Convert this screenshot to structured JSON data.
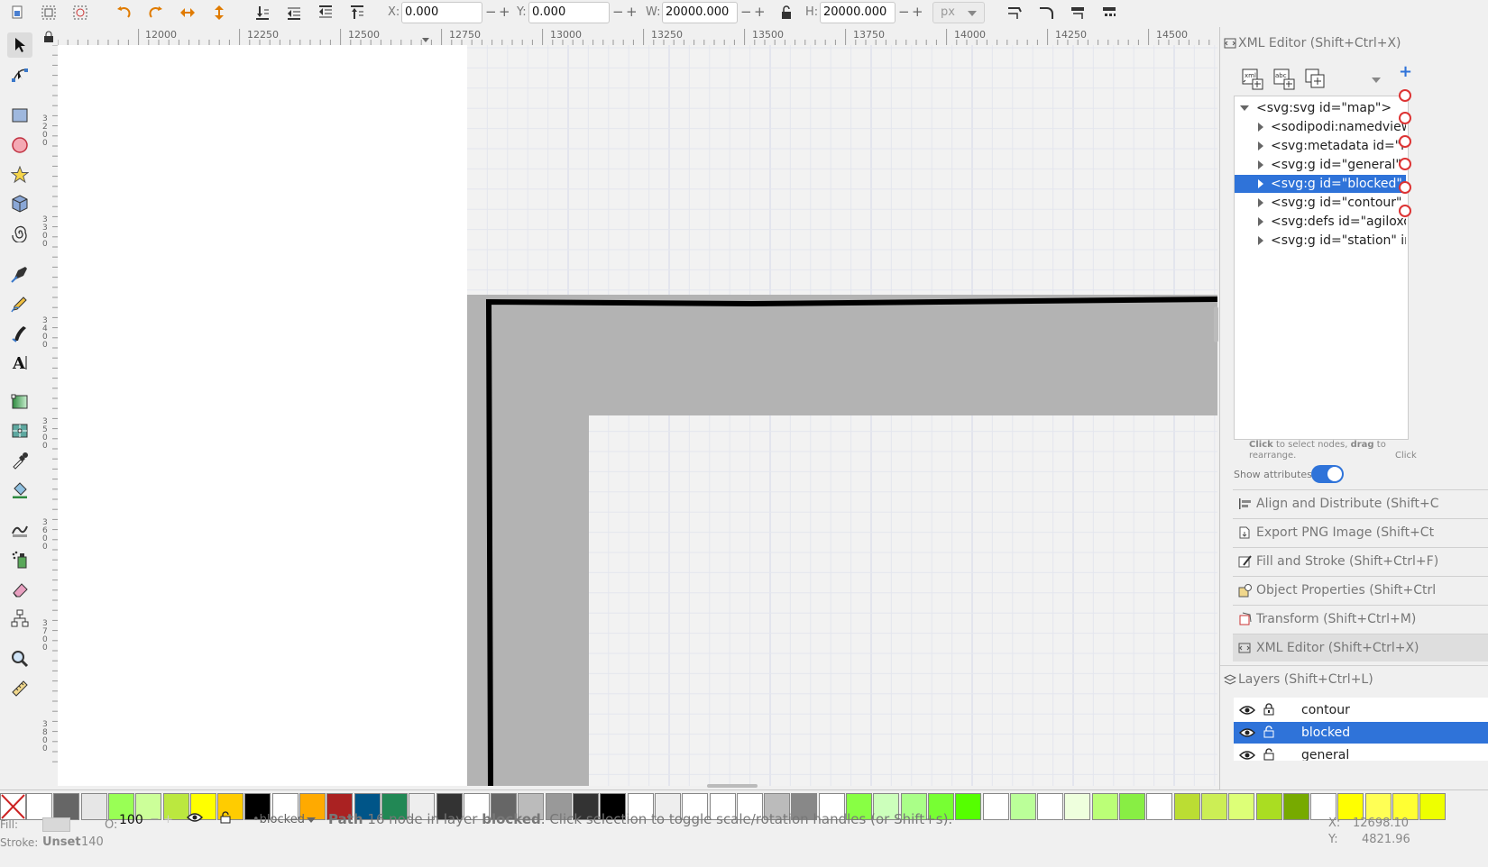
{
  "toolbar": {
    "x_label": "X:",
    "x_value": "0.000",
    "y_label": "Y:",
    "y_value": "0.000",
    "w_label": "W:",
    "w_value": "20000.000",
    "h_label": "H:",
    "h_value": "20000.000",
    "unit": "px",
    "minus": "−",
    "plus": "+"
  },
  "ruler": {
    "labels": [
      "12000",
      "12250",
      "12500",
      "12750",
      "13000",
      "13250",
      "13500",
      "13750",
      "14000",
      "14250",
      "14500"
    ],
    "vlabels": [
      "3200",
      "3300",
      "3400",
      "3500",
      "3600",
      "3700",
      "3800"
    ]
  },
  "xml_editor": {
    "title": "XML Editor (Shift+Ctrl+X)",
    "nodes": [
      {
        "label": "<svg:svg id=\"map\">",
        "expanded": true,
        "selected": false
      },
      {
        "label": "<sodipodi:namedview",
        "selected": false
      },
      {
        "label": "<svg:metadata id=\"m",
        "selected": false
      },
      {
        "label": "<svg:g id=\"general\" i",
        "selected": false
      },
      {
        "label": "<svg:g id=\"blocked\" i",
        "selected": true
      },
      {
        "label": "<svg:g id=\"contour\" i",
        "selected": false
      },
      {
        "label": "<svg:defs id=\"agiloxo",
        "selected": false
      },
      {
        "label": "<svg:g id=\"station\" in",
        "selected": false
      }
    ],
    "hint_bold1": "Click",
    "hint_text1": " to select nodes, ",
    "hint_bold2": "drag",
    "hint_text2": " to rearrange.",
    "hint_right": "Click",
    "show_attributes_label": "Show attributes",
    "show_attributes": true
  },
  "docks": [
    {
      "label": "Align and Distribute (Shift+C",
      "icon": "align-icon"
    },
    {
      "label": "Export PNG Image (Shift+Ct",
      "icon": "export-icon"
    },
    {
      "label": "Fill and Stroke (Shift+Ctrl+F)",
      "icon": "fill-stroke-icon"
    },
    {
      "label": "Object Properties (Shift+Ctrl",
      "icon": "object-properties-icon"
    },
    {
      "label": "Transform (Shift+Ctrl+M)",
      "icon": "transform-icon"
    },
    {
      "label": "XML Editor (Shift+Ctrl+X)",
      "icon": "xml-editor-icon"
    }
  ],
  "layers": {
    "title": "Layers (Shift+Ctrl+L)",
    "items": [
      {
        "name": "contour",
        "selected": false
      },
      {
        "name": "blocked",
        "selected": true
      },
      {
        "name": "general",
        "selected": false
      }
    ]
  },
  "palette": {
    "colors": [
      "#ffffff",
      "#666666",
      "#e6e6e6",
      "#99ff55",
      "#ccff99",
      "#bbe83f",
      "#ffff00",
      "#ffcc00",
      "#000000",
      "#ffffff",
      "#ffaa00",
      "#aa2222",
      "#005588",
      "#228855",
      "#eeeeee",
      "#333333",
      "#ffffff",
      "#666666",
      "#bbbbbb",
      "#999999",
      "#333333",
      "#000000",
      "#ffffff",
      "#eeeeee",
      "#ffffff",
      "#ffffff",
      "#ffffff",
      "#bbbbbb",
      "#888888",
      "#ffffff",
      "#88ff44",
      "#ccffbb",
      "#aaff88",
      "#77ff33",
      "#55ff00",
      "#ffffff",
      "#bbff99",
      "#ffffff",
      "#eeffdd",
      "#bbff77",
      "#88ee44",
      "#ffffff",
      "#bbdd33",
      "#ccee55",
      "#ddff77",
      "#aadd22",
      "#77aa00",
      "#ffffff",
      "#ffff00",
      "#ffff55",
      "#ffff33",
      "#eeff00"
    ]
  },
  "status": {
    "fill_label": "Fill:",
    "stroke_label": "Stroke:",
    "stroke_value": "Unset",
    "stroke_width": "140",
    "opacity_label": "O:",
    "opacity_value": "100",
    "layer_name": "•blocked",
    "msg_bold1": "Path",
    "msg_text1": " 16 node in layer ",
    "msg_bold2": "blocked",
    "msg_text2": ". Click selection to toggle scale/rotation handles (or Shift+s).",
    "x_label": "X:",
    "x_coord": "12698.10",
    "y_label": "Y:",
    "y_coord": "4821.96"
  }
}
